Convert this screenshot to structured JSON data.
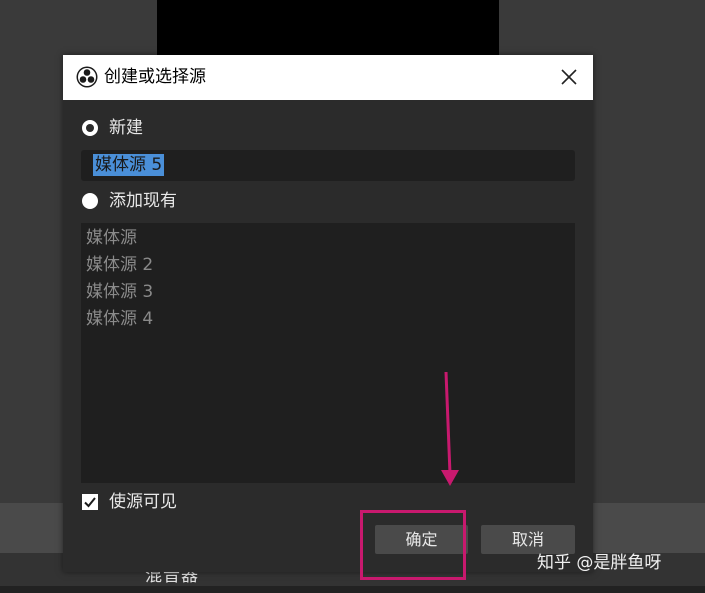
{
  "dialog": {
    "title": "创建或选择源",
    "close_label": "",
    "create_new_label": "新建",
    "new_source_name": "媒体源 5",
    "add_existing_label": "添加现有",
    "existing_sources": [
      "媒体源",
      "媒体源 2",
      "媒体源 3",
      "媒体源 4"
    ],
    "make_visible_label": "使源可见",
    "make_visible_checked": true,
    "ok_label": "确定",
    "cancel_label": "取消"
  },
  "background": {
    "lower_panel_text": "混音器"
  },
  "watermark": "知乎 @是胖鱼呀",
  "colors": {
    "dialog_bg": "#2b2b2b",
    "field_bg": "#1f1f1f",
    "selection": "#4a8fd8",
    "annotation": "#c8196e"
  },
  "icons": [
    "obs-logo-icon",
    "close-icon",
    "checkmark-icon",
    "annotation-arrow"
  ]
}
